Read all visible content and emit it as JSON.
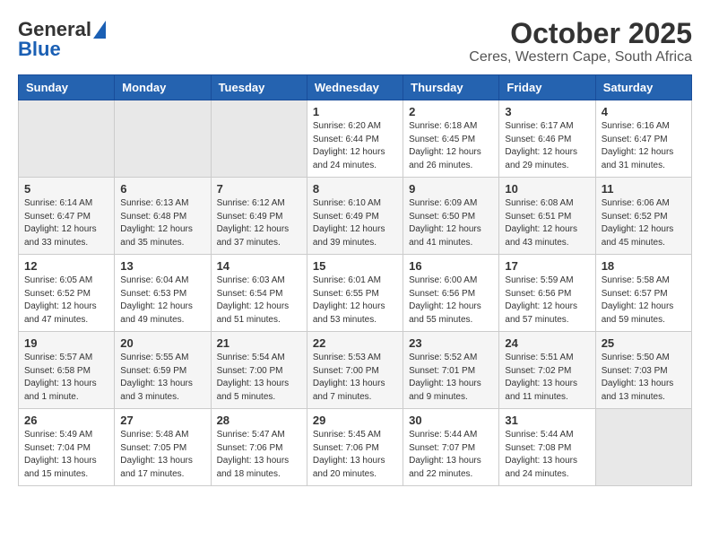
{
  "logo": {
    "line1": "General",
    "line2": "Blue"
  },
  "title": "October 2025",
  "subtitle": "Ceres, Western Cape, South Africa",
  "days_of_week": [
    "Sunday",
    "Monday",
    "Tuesday",
    "Wednesday",
    "Thursday",
    "Friday",
    "Saturday"
  ],
  "weeks": [
    [
      {
        "day": "",
        "info": ""
      },
      {
        "day": "",
        "info": ""
      },
      {
        "day": "",
        "info": ""
      },
      {
        "day": "1",
        "info": "Sunrise: 6:20 AM\nSunset: 6:44 PM\nDaylight: 12 hours\nand 24 minutes."
      },
      {
        "day": "2",
        "info": "Sunrise: 6:18 AM\nSunset: 6:45 PM\nDaylight: 12 hours\nand 26 minutes."
      },
      {
        "day": "3",
        "info": "Sunrise: 6:17 AM\nSunset: 6:46 PM\nDaylight: 12 hours\nand 29 minutes."
      },
      {
        "day": "4",
        "info": "Sunrise: 6:16 AM\nSunset: 6:47 PM\nDaylight: 12 hours\nand 31 minutes."
      }
    ],
    [
      {
        "day": "5",
        "info": "Sunrise: 6:14 AM\nSunset: 6:47 PM\nDaylight: 12 hours\nand 33 minutes."
      },
      {
        "day": "6",
        "info": "Sunrise: 6:13 AM\nSunset: 6:48 PM\nDaylight: 12 hours\nand 35 minutes."
      },
      {
        "day": "7",
        "info": "Sunrise: 6:12 AM\nSunset: 6:49 PM\nDaylight: 12 hours\nand 37 minutes."
      },
      {
        "day": "8",
        "info": "Sunrise: 6:10 AM\nSunset: 6:49 PM\nDaylight: 12 hours\nand 39 minutes."
      },
      {
        "day": "9",
        "info": "Sunrise: 6:09 AM\nSunset: 6:50 PM\nDaylight: 12 hours\nand 41 minutes."
      },
      {
        "day": "10",
        "info": "Sunrise: 6:08 AM\nSunset: 6:51 PM\nDaylight: 12 hours\nand 43 minutes."
      },
      {
        "day": "11",
        "info": "Sunrise: 6:06 AM\nSunset: 6:52 PM\nDaylight: 12 hours\nand 45 minutes."
      }
    ],
    [
      {
        "day": "12",
        "info": "Sunrise: 6:05 AM\nSunset: 6:52 PM\nDaylight: 12 hours\nand 47 minutes."
      },
      {
        "day": "13",
        "info": "Sunrise: 6:04 AM\nSunset: 6:53 PM\nDaylight: 12 hours\nand 49 minutes."
      },
      {
        "day": "14",
        "info": "Sunrise: 6:03 AM\nSunset: 6:54 PM\nDaylight: 12 hours\nand 51 minutes."
      },
      {
        "day": "15",
        "info": "Sunrise: 6:01 AM\nSunset: 6:55 PM\nDaylight: 12 hours\nand 53 minutes."
      },
      {
        "day": "16",
        "info": "Sunrise: 6:00 AM\nSunset: 6:56 PM\nDaylight: 12 hours\nand 55 minutes."
      },
      {
        "day": "17",
        "info": "Sunrise: 5:59 AM\nSunset: 6:56 PM\nDaylight: 12 hours\nand 57 minutes."
      },
      {
        "day": "18",
        "info": "Sunrise: 5:58 AM\nSunset: 6:57 PM\nDaylight: 12 hours\nand 59 minutes."
      }
    ],
    [
      {
        "day": "19",
        "info": "Sunrise: 5:57 AM\nSunset: 6:58 PM\nDaylight: 13 hours\nand 1 minute."
      },
      {
        "day": "20",
        "info": "Sunrise: 5:55 AM\nSunset: 6:59 PM\nDaylight: 13 hours\nand 3 minutes."
      },
      {
        "day": "21",
        "info": "Sunrise: 5:54 AM\nSunset: 7:00 PM\nDaylight: 13 hours\nand 5 minutes."
      },
      {
        "day": "22",
        "info": "Sunrise: 5:53 AM\nSunset: 7:00 PM\nDaylight: 13 hours\nand 7 minutes."
      },
      {
        "day": "23",
        "info": "Sunrise: 5:52 AM\nSunset: 7:01 PM\nDaylight: 13 hours\nand 9 minutes."
      },
      {
        "day": "24",
        "info": "Sunrise: 5:51 AM\nSunset: 7:02 PM\nDaylight: 13 hours\nand 11 minutes."
      },
      {
        "day": "25",
        "info": "Sunrise: 5:50 AM\nSunset: 7:03 PM\nDaylight: 13 hours\nand 13 minutes."
      }
    ],
    [
      {
        "day": "26",
        "info": "Sunrise: 5:49 AM\nSunset: 7:04 PM\nDaylight: 13 hours\nand 15 minutes."
      },
      {
        "day": "27",
        "info": "Sunrise: 5:48 AM\nSunset: 7:05 PM\nDaylight: 13 hours\nand 17 minutes."
      },
      {
        "day": "28",
        "info": "Sunrise: 5:47 AM\nSunset: 7:06 PM\nDaylight: 13 hours\nand 18 minutes."
      },
      {
        "day": "29",
        "info": "Sunrise: 5:45 AM\nSunset: 7:06 PM\nDaylight: 13 hours\nand 20 minutes."
      },
      {
        "day": "30",
        "info": "Sunrise: 5:44 AM\nSunset: 7:07 PM\nDaylight: 13 hours\nand 22 minutes."
      },
      {
        "day": "31",
        "info": "Sunrise: 5:44 AM\nSunset: 7:08 PM\nDaylight: 13 hours\nand 24 minutes."
      },
      {
        "day": "",
        "info": ""
      }
    ]
  ]
}
